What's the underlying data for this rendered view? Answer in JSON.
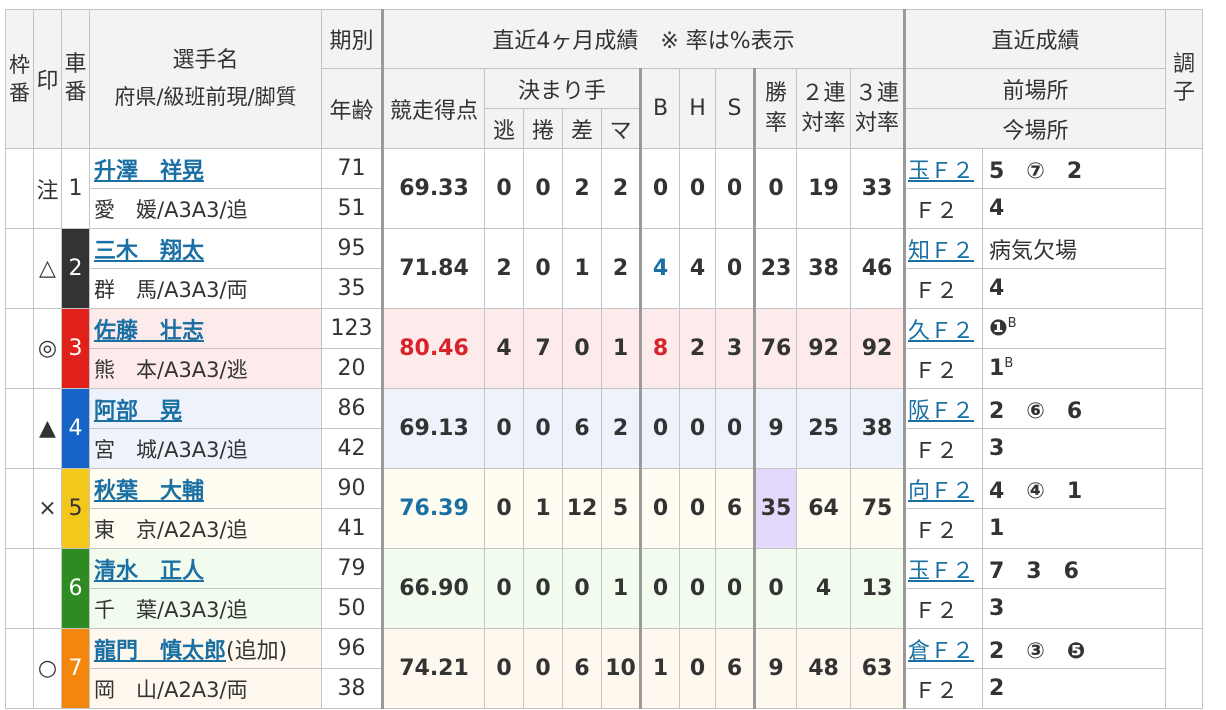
{
  "header": {
    "waku": "枠番",
    "shirushi": "印",
    "shaban": "車番",
    "name": "選手名",
    "sub": "府県/級班前現/脚質",
    "kibetsu": "期別",
    "nenrei": "年齢",
    "recent4": "直近4ヶ月成績　※ 率は%表示",
    "score": "競走得点",
    "kimarite": "決まり手",
    "nige": "逃",
    "makuri": "捲",
    "sashi": "差",
    "ma": "マ",
    "b": "B",
    "h": "H",
    "s": "S",
    "win": "勝率",
    "ren2": "２連対率",
    "ren3": "３連対率",
    "recent": "直近成績",
    "prev": "前場所",
    "now": "今場所",
    "choshi": "調子"
  },
  "colors": {
    "row_bg": [
      "#ffffff",
      "#ffffff",
      "#fdeaea",
      "#eef2fb",
      "#fffdf2",
      "#f1fbee",
      "#fff8ee"
    ],
    "car_bg": [
      "#ffffff",
      "#333333",
      "#e0201b",
      "#1663c7",
      "#f4c81a",
      "#2e8b22",
      "#f3860d"
    ],
    "car_fg": [
      "#333333",
      "#ffffff",
      "#ffffff",
      "#ffffff",
      "#333333",
      "#ffffff",
      "#ffffff"
    ],
    "score_red": "#d8232a",
    "score_blue": "#1a6fa3",
    "highlight_win": "#e4d8fb"
  },
  "rows": [
    {
      "mark": "注",
      "car": "1",
      "name": "升澤　祥晃",
      "extra": "",
      "pref": "愛　媛/A3A3/追",
      "ki": "71",
      "age": "51",
      "score": "69.33",
      "nige": "0",
      "makuri": "0",
      "sashi": "2",
      "ma": "2",
      "b": "0",
      "h": "0",
      "s": "0",
      "win": "0",
      "r2": "19",
      "r3": "33",
      "prev_link": "玉Ｆ２",
      "prev_res": "5　⑦　2",
      "now_link": "Ｆ２",
      "now_res": "4"
    },
    {
      "mark": "△",
      "car": "2",
      "name": "三木　翔太",
      "extra": "",
      "pref": "群　馬/A3A3/両",
      "ki": "95",
      "age": "35",
      "score": "71.84",
      "nige": "2",
      "makuri": "0",
      "sashi": "1",
      "ma": "2",
      "b": "4",
      "h": "4",
      "s": "0",
      "win": "23",
      "r2": "38",
      "r3": "46",
      "prev_link": "知Ｆ２",
      "prev_res": "病気欠場",
      "now_link": "Ｆ２",
      "now_res": "4"
    },
    {
      "mark": "◎",
      "car": "3",
      "name": "佐藤　壮志",
      "extra": "",
      "pref": "熊　本/A3A3/逃",
      "ki": "123",
      "age": "20",
      "score": "80.46",
      "nige": "4",
      "makuri": "7",
      "sashi": "0",
      "ma": "1",
      "b": "8",
      "h": "2",
      "s": "3",
      "win": "76",
      "r2": "92",
      "r3": "92",
      "prev_link": "久Ｆ２",
      "prev_res": "❶",
      "prev_sup": "B",
      "now_link": "Ｆ２",
      "now_res": "1",
      "now_sup": "B"
    },
    {
      "mark": "▲",
      "car": "4",
      "name": "阿部　晃",
      "extra": "",
      "pref": "宮　城/A3A3/追",
      "ki": "86",
      "age": "42",
      "score": "69.13",
      "nige": "0",
      "makuri": "0",
      "sashi": "6",
      "ma": "2",
      "b": "0",
      "h": "0",
      "s": "0",
      "win": "9",
      "r2": "25",
      "r3": "38",
      "prev_link": "阪Ｆ２",
      "prev_res": "2　⑥　6",
      "now_link": "Ｆ２",
      "now_res": "3"
    },
    {
      "mark": "×",
      "car": "5",
      "name": "秋葉　大輔",
      "extra": "",
      "pref": "東　京/A2A3/追",
      "ki": "90",
      "age": "41",
      "score": "76.39",
      "nige": "0",
      "makuri": "1",
      "sashi": "12",
      "ma": "5",
      "b": "0",
      "h": "0",
      "s": "6",
      "win": "35",
      "r2": "64",
      "r3": "75",
      "prev_link": "向Ｆ２",
      "prev_res": "4　④　1",
      "now_link": "Ｆ２",
      "now_res": "1"
    },
    {
      "mark": "",
      "car": "6",
      "name": "清水　正人",
      "extra": "",
      "pref": "千　葉/A3A3/追",
      "ki": "79",
      "age": "50",
      "score": "66.90",
      "nige": "0",
      "makuri": "0",
      "sashi": "0",
      "ma": "1",
      "b": "0",
      "h": "0",
      "s": "0",
      "win": "0",
      "r2": "4",
      "r3": "13",
      "prev_link": "玉Ｆ２",
      "prev_res": "7　3　6",
      "now_link": "Ｆ２",
      "now_res": "3"
    },
    {
      "mark": "○",
      "car": "7",
      "name": "龍門　慎太郎",
      "extra": "(追加)",
      "pref": "岡　山/A2A3/両",
      "ki": "96",
      "age": "38",
      "score": "74.21",
      "nige": "0",
      "makuri": "0",
      "sashi": "6",
      "ma": "10",
      "b": "1",
      "h": "0",
      "s": "6",
      "win": "9",
      "r2": "48",
      "r3": "63",
      "prev_link": "倉Ｆ２",
      "prev_res": "2　③　❺",
      "now_link": "Ｆ２",
      "now_res": "2"
    }
  ]
}
